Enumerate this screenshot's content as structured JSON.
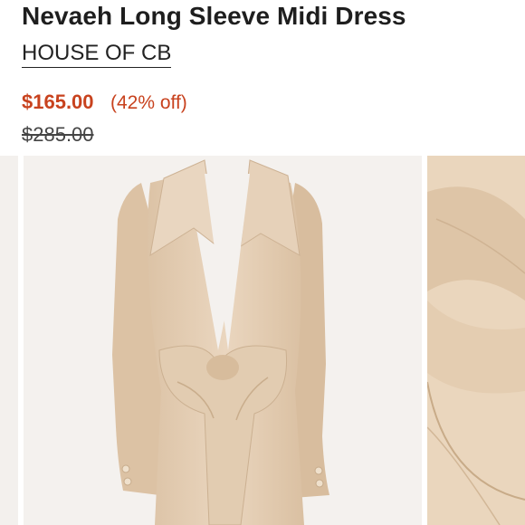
{
  "product": {
    "title": "Nevaeh Long Sleeve Midi Dress",
    "brand": "HOUSE OF CB",
    "price": "$165.00",
    "discount": "(42% off)",
    "original_price": "$285.00"
  },
  "colors": {
    "accent": "#c8421e",
    "fabric": "#e6cfb5",
    "background": "#f4f1ee"
  },
  "gallery": {
    "images": [
      "dress-front-photo",
      "dress-detail-photo"
    ]
  }
}
